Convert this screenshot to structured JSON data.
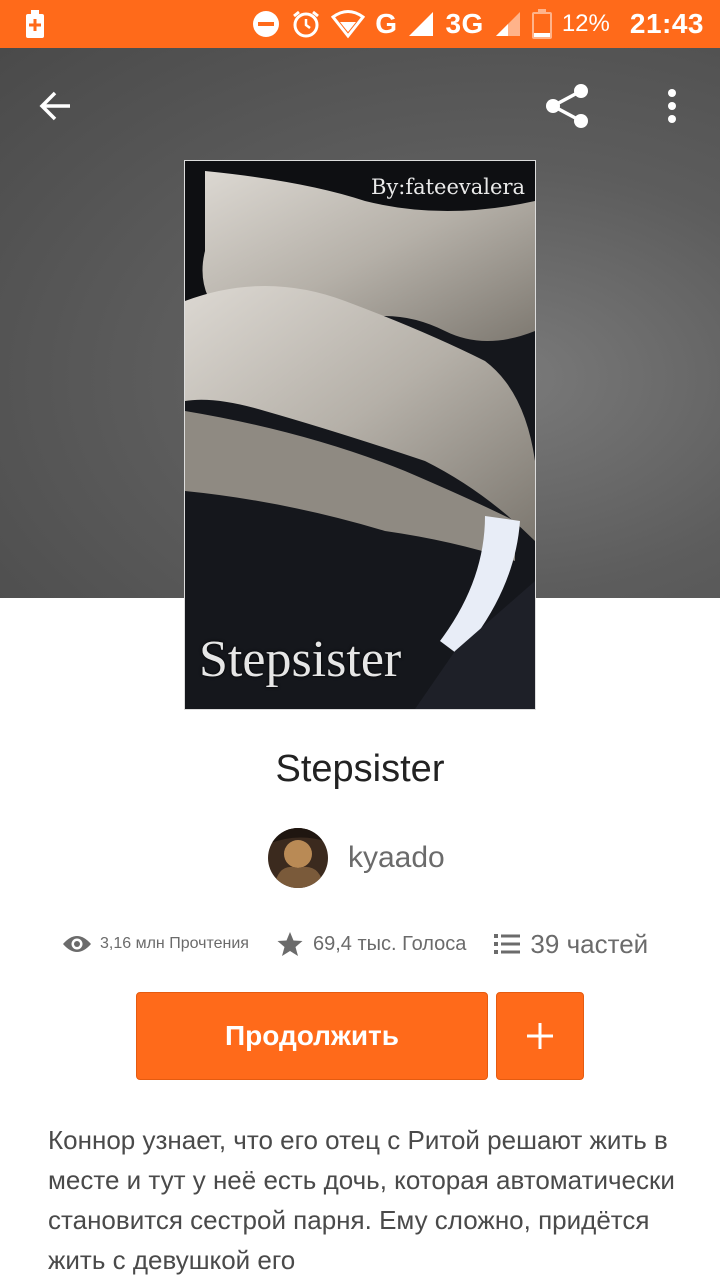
{
  "status_bar": {
    "network_g": "G",
    "network_3g": "3G",
    "battery_percent": "12%",
    "time": "21:43"
  },
  "cover": {
    "author_credit": "By:fateevalera",
    "title": "Stepsister"
  },
  "story": {
    "title": "Stepsister",
    "author": "kyaado"
  },
  "stats": {
    "reads": "3,16 млн Прочтения",
    "votes": "69,4 тыс. Голоса",
    "parts": "39 частей"
  },
  "actions": {
    "continue_label": "Продолжить",
    "add_label": "+"
  },
  "description": "Коннор узнает, что его отец с Ритой решают жить в месте и тут у неё есть дочь, которая автоматически становится сестрой парня. Ему сложно, придётся жить с девушкой его",
  "colors": {
    "accent": "#ff6a1a",
    "header_bg": "#5d5d5d"
  }
}
